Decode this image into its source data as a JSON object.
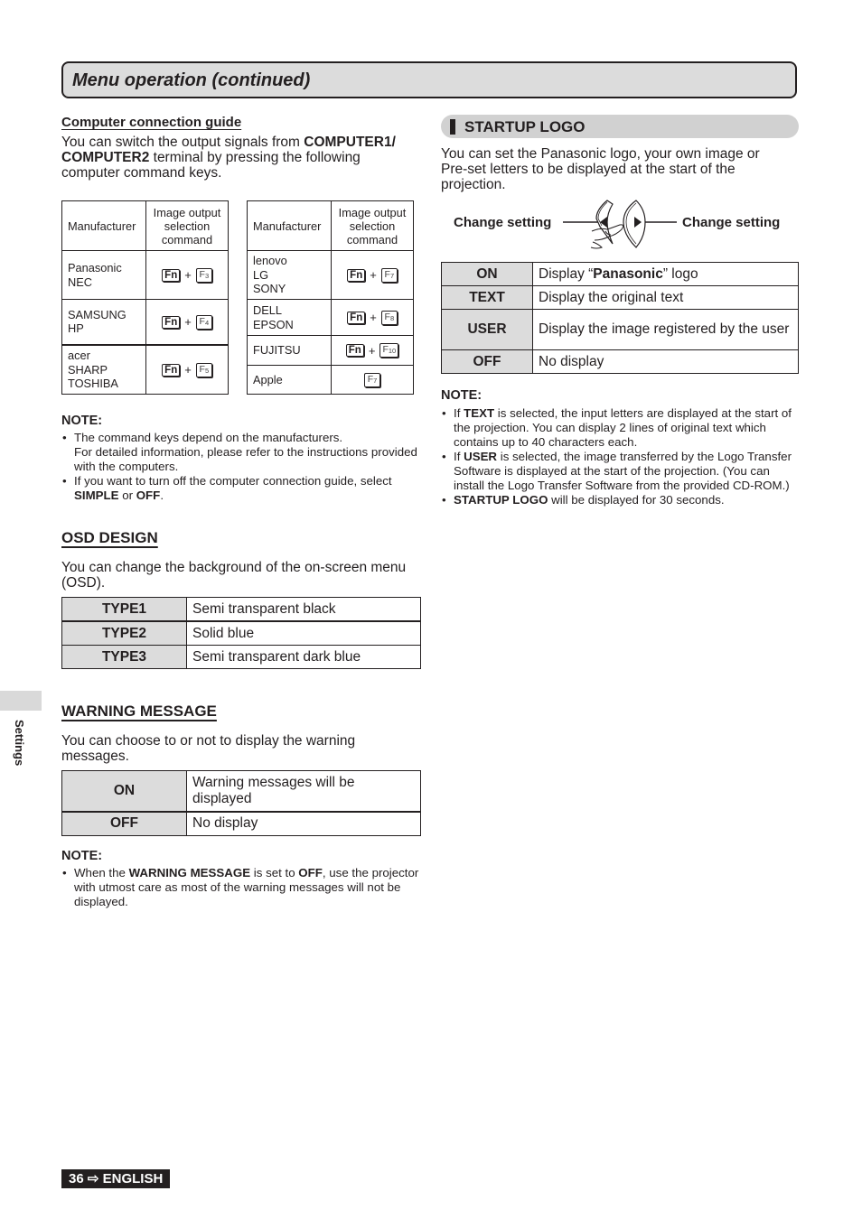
{
  "header": {
    "title": "Menu operation (continued)"
  },
  "side_tab": {
    "label": "Settings"
  },
  "computer_guide": {
    "heading": "Computer connection guide",
    "intro_pre": "You can switch the output signals from ",
    "intro_bold1": "COMPUTER1/",
    "intro_bold2": "COMPUTER2",
    "intro_post": " terminal by pressing the following computer command keys.",
    "table_left": {
      "col_manufacturer": "Manufacturer",
      "col_command": "Image output selection command",
      "rows": [
        {
          "names": [
            "Panasonic",
            "NEC"
          ],
          "fn": "Fn",
          "plus": "+",
          "fkey": "F",
          "fnum": "3"
        },
        {
          "names": [
            "SAMSUNG",
            "HP"
          ],
          "fn": "Fn",
          "plus": "+",
          "fkey": "F",
          "fnum": "4"
        },
        {
          "names": [
            "acer",
            "SHARP",
            "TOSHIBA"
          ],
          "fn": "Fn",
          "plus": "+",
          "fkey": "F",
          "fnum": "5"
        }
      ]
    },
    "table_right": {
      "col_manufacturer": "Manufacturer",
      "col_command": "Image output selection command",
      "rows": [
        {
          "names": [
            "lenovo",
            "LG",
            "SONY"
          ],
          "fn": "Fn",
          "plus": "+",
          "fkey": "F",
          "fnum": "7"
        },
        {
          "names": [
            "DELL",
            "EPSON"
          ],
          "fn": "Fn",
          "plus": "+",
          "fkey": "F",
          "fnum": "8"
        },
        {
          "names": [
            "FUJITSU"
          ],
          "fn": "Fn",
          "plus": "+",
          "fkey": "F",
          "fnum": "10"
        },
        {
          "names": [
            "Apple"
          ],
          "fkey": "F",
          "fnum": "7"
        }
      ]
    },
    "note_title": "NOTE:",
    "notes": {
      "n1_line1": "The command keys depend on the manufacturers.",
      "n1_line2": "For detailed information, please refer to the instructions provided with the computers.",
      "n2_pre": "If you want to turn off the computer connection guide, select ",
      "n2_bold1": "SIMPLE",
      "n2_mid": " or ",
      "n2_bold2": "OFF",
      "n2_post": "."
    }
  },
  "osd_design": {
    "heading": "OSD DESIGN",
    "intro": "You can change the background of the on-screen menu (OSD).",
    "rows": [
      {
        "key": "TYPE1",
        "value": "Semi transparent black"
      },
      {
        "key": "TYPE2",
        "value": "Solid blue"
      },
      {
        "key": "TYPE3",
        "value": "Semi transparent dark blue"
      }
    ]
  },
  "warning_message": {
    "heading": "WARNING MESSAGE",
    "intro": "You can choose to or not to display the warning messages.",
    "rows": [
      {
        "key": "ON",
        "value": "Warning messages will be displayed"
      },
      {
        "key": "OFF",
        "value": "No display"
      }
    ],
    "note_title": "NOTE:",
    "note_pre": "When the ",
    "note_bold1": "WARNING MESSAGE",
    "note_mid": " is set to ",
    "note_bold2": "OFF",
    "note_post": ", use the projector with utmost care as most of the warning messages will not be displayed."
  },
  "startup_logo": {
    "heading": "STARTUP LOGO",
    "intro": "You can set the Panasonic logo, your own image or Pre-set letters to be displayed at the start of the projection.",
    "change_left": "Change setting",
    "change_right": "Change setting",
    "rows": [
      {
        "key": "ON",
        "value_pre": "Display “",
        "value_bold": "Panasonic",
        "value_post": "” logo"
      },
      {
        "key": "TEXT",
        "value": "Display the original text"
      },
      {
        "key": "USER",
        "value": "Display the image registered by the user"
      },
      {
        "key": "OFF",
        "value": "No display"
      }
    ],
    "note_title": "NOTE:",
    "notes": {
      "n1_pre": "If ",
      "n1_bold": "TEXT",
      "n1_post": " is selected, the input letters are displayed at the start of the projection. You can display 2 lines of original text which contains up to 40 characters each.",
      "n2_pre": "If ",
      "n2_bold": "USER",
      "n2_post": " is selected, the image transferred by the Logo Transfer Software is displayed at the start of the projection. (You can install the Logo Transfer Software from the provided CD-ROM.)",
      "n3_bold": "STARTUP LOGO",
      "n3_post": " will be displayed for 30 seconds."
    }
  },
  "footer": {
    "page": "36",
    "arrow": "⇨",
    "language": "ENGLISH"
  }
}
